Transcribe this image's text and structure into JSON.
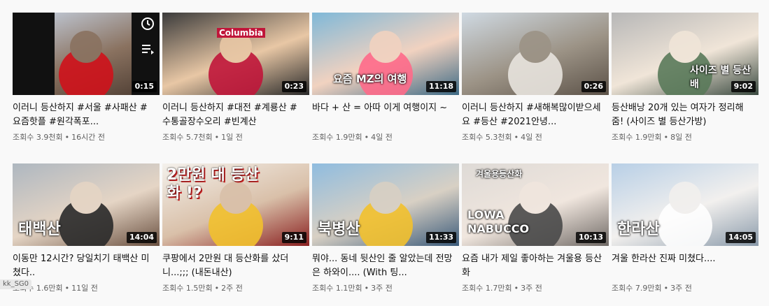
{
  "videos": [
    {
      "title": "이러니 등산하지 #서울 #사패산 #요즘핫플 #원각폭포...",
      "views": "조회수 3.9천회",
      "age": "16시간 전",
      "duration": "0:15",
      "overlay": "",
      "colors": [
        "#c8d6e8",
        "#8a7260",
        "#4a3a30"
      ],
      "accent": "#d0121b"
    },
    {
      "title": "이러니 등산하지 #대전 #계룡산 #수통골장수오리 #빈계산",
      "views": "조회수 5.7천회",
      "age": "1일 전",
      "duration": "0:23",
      "overlay": "Columbia",
      "colors": [
        "#3b3b3b",
        "#e8c7a5",
        "#2a2a2a"
      ],
      "accent": "#c0163a"
    },
    {
      "title": "바다 + 산 = 아따 이게 여행이지 ~",
      "views": "조회수 1.9만회",
      "age": "4일 전",
      "duration": "11:18",
      "overlay": "요즘 MZ의 여행",
      "colors": [
        "#7fb8d8",
        "#f1d2c0",
        "#3d6a85"
      ],
      "accent": "#ff6b8a"
    },
    {
      "title": "이러니 등산하지 #새해복많이받으세요 #등산 #2021안녕...",
      "views": "조회수 5.3천회",
      "age": "4일 전",
      "duration": "0:26",
      "overlay": "",
      "colors": [
        "#cfd9e2",
        "#9c9386",
        "#5c5248"
      ],
      "accent": "#e8e4de"
    },
    {
      "title": "등산배낭 20개 있는 여자가 정리해줌! (사이즈 별 등산가방)",
      "views": "조회수 1.9만회",
      "age": "8일 전",
      "duration": "9:02",
      "overlay": "사이즈 별 등산배",
      "colors": [
        "#b7b7b7",
        "#f0e5d8",
        "#3a4a40"
      ],
      "accent": "#5a7a5a"
    },
    {
      "title": "이동만 12시간? 당일치기 태백산 미쳤다..",
      "views": "조회수 1.6만회",
      "age": "11일 전",
      "duration": "14:04",
      "overlay": "태백산",
      "colors": [
        "#aeb7c0",
        "#e5d5c5",
        "#6a5040"
      ],
      "accent": "#2a2a2a"
    },
    {
      "title": "쿠팡에서 2만원 대 등산화를 샀더니...;;; (내돈내산)",
      "views": "조회수 1.5만회",
      "age": "2주 전",
      "duration": "9:11",
      "overlay": "2만원 대 등산화 !?",
      "colors": [
        "#f4f1ec",
        "#d9c0a9",
        "#8a2020"
      ],
      "accent": "#f2c12e"
    },
    {
      "title": "뭐야... 동네 뒷산인 줄 알았는데 전망은 하와이.... (With 팅...",
      "views": "조회수 1.1만회",
      "age": "3주 전",
      "duration": "11:33",
      "overlay": "북병산",
      "colors": [
        "#8fbcdf",
        "#d8d0c4",
        "#3a5a7a"
      ],
      "accent": "#f2c12e"
    },
    {
      "title": "요즘 내가 제일 좋아하는 겨울용 등산화",
      "views": "조회수 1.7만회",
      "age": "3주 전",
      "duration": "10:13",
      "overlay": "LOWA NABUCCO",
      "overlay_top": "겨울용등산화",
      "colors": [
        "#dedad6",
        "#f0e6de",
        "#706a66"
      ],
      "accent": "#4a4a4a"
    },
    {
      "title": "겨울 한라산 진짜 미쳤다....",
      "views": "조회수 7.9만회",
      "age": "3주 전",
      "duration": "14:05",
      "overlay": "한라산",
      "colors": [
        "#b8cfe6",
        "#f2f0ee",
        "#8a9aaa"
      ],
      "accent": "#ffffff"
    }
  ],
  "status_text": "kk_SG0",
  "icons": {
    "watch_later": "clock-icon",
    "add_to_queue": "queue-icon"
  }
}
